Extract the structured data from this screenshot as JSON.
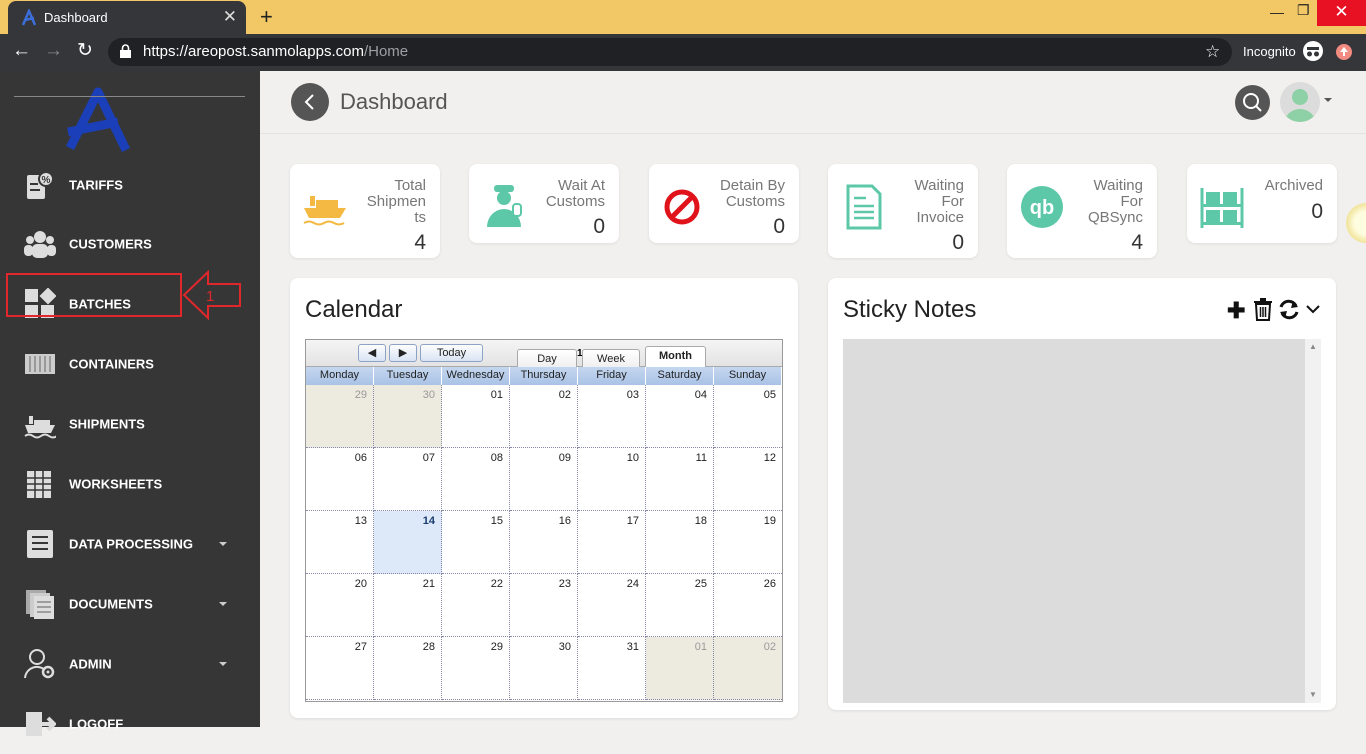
{
  "browser": {
    "tab_title": "Dashboard",
    "url_host": "https://areopost.sanmolapps.com",
    "url_path": "/Home",
    "incognito_label": "Incognito"
  },
  "sidebar": {
    "items": [
      {
        "label": "TARIFFS",
        "icon": "tariff-icon"
      },
      {
        "label": "CUSTOMERS",
        "icon": "customers-icon"
      },
      {
        "label": "BATCHES",
        "icon": "batches-icon"
      },
      {
        "label": "CONTAINERS",
        "icon": "container-icon"
      },
      {
        "label": "SHIPMENTS",
        "icon": "ship-icon"
      },
      {
        "label": "WORKSHEETS",
        "icon": "worksheet-icon"
      },
      {
        "label": "DATA PROCESSING",
        "icon": "data-processing-icon"
      },
      {
        "label": "DOCUMENTS",
        "icon": "documents-icon"
      },
      {
        "label": "ADMIN",
        "icon": "admin-icon"
      },
      {
        "label": "LOGOFF",
        "icon": "logoff-icon"
      }
    ],
    "highlight_number": "1"
  },
  "header": {
    "title": "Dashboard"
  },
  "stats": [
    {
      "label_lines": [
        "Total",
        "Shipmen",
        "ts"
      ],
      "value": "4",
      "icon": "cargo-ship-icon"
    },
    {
      "label_lines": [
        "Wait At",
        "Customs"
      ],
      "value": "0",
      "icon": "customs-officer-icon"
    },
    {
      "label_lines": [
        "Detain By",
        "Customs"
      ],
      "value": "0",
      "icon": "prohibited-icon"
    },
    {
      "label_lines": [
        "Waiting",
        "For",
        "Invoice"
      ],
      "value": "0",
      "icon": "bill-icon"
    },
    {
      "label_lines": [
        "Waiting",
        "For",
        "QBSync"
      ],
      "value": "4",
      "icon": "quickbooks-icon"
    },
    {
      "label_lines": [
        "Archived"
      ],
      "value": "0",
      "icon": "archive-shelf-icon"
    }
  ],
  "calendar": {
    "title": "Calendar",
    "today_label": "Today",
    "views": [
      "Day",
      "Week",
      "Month"
    ],
    "stray_char": "1",
    "active_view": "Month",
    "weekdays": [
      "Monday",
      "Tuesday",
      "Wednesday",
      "Thursday",
      "Friday",
      "Saturday",
      "Sunday"
    ],
    "weeks": [
      [
        "29",
        "30",
        "01",
        "02",
        "03",
        "04",
        "05"
      ],
      [
        "06",
        "07",
        "08",
        "09",
        "10",
        "11",
        "12"
      ],
      [
        "13",
        "14",
        "15",
        "16",
        "17",
        "18",
        "19"
      ],
      [
        "20",
        "21",
        "22",
        "23",
        "24",
        "25",
        "26"
      ],
      [
        "27",
        "28",
        "29",
        "30",
        "31",
        "01",
        "02"
      ]
    ],
    "other_month_cells": [
      [
        0,
        0
      ],
      [
        0,
        1
      ],
      [
        4,
        5
      ],
      [
        4,
        6
      ]
    ],
    "today_cell": [
      2,
      1
    ]
  },
  "sticky": {
    "title": "Sticky Notes"
  },
  "colors": {
    "accent_teal": "#5cc8a8",
    "highlight_red": "#e0272c",
    "sidebar_bg": "#363636",
    "logo_blue": "#1b3fb8"
  }
}
